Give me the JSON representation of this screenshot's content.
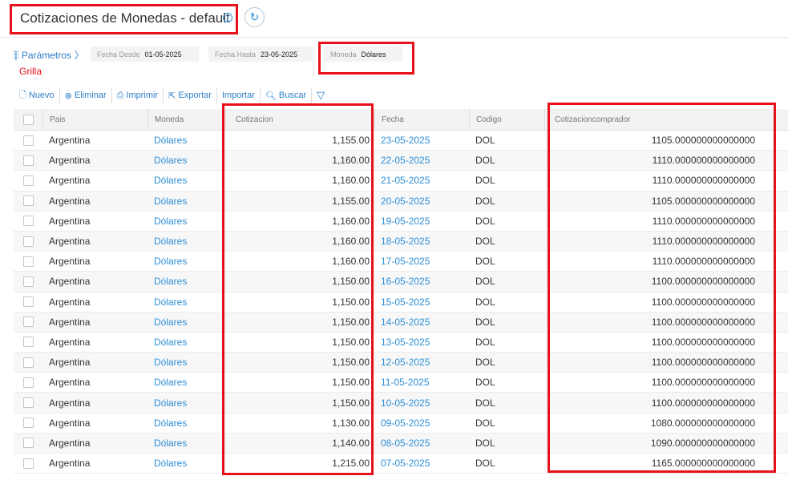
{
  "header": {
    "title": "Cotizaciones de Monedas - default",
    "info_icon": "info-icon",
    "refresh_icon": "refresh-icon"
  },
  "params": {
    "label": "Parámetros",
    "filters": {
      "fecha_desde": {
        "label": "Fecha Desde",
        "value": "01-05-2025"
      },
      "fecha_hasta": {
        "label": "Fecha Hasta",
        "value": "23-05-2025"
      },
      "moneda": {
        "label": "Moneda",
        "value": "Dólares"
      }
    }
  },
  "grilla_label": "Grilla",
  "toolbar": {
    "nuevo": "Nuevo",
    "eliminar": "Eliminar",
    "imprimir": "Imprimir",
    "exportar": "Exportar",
    "importar": "Importar",
    "buscar": "Buscar"
  },
  "table": {
    "columns": [
      "Pais",
      "Moneda",
      "Cotizacion",
      "Fecha",
      "Codigo",
      "Cotizacioncomprador"
    ],
    "rows": [
      {
        "pais": "Argentina",
        "moneda": "Dólares",
        "cotizacion": "1,155.00",
        "fecha": "23-05-2025",
        "codigo": "DOL",
        "comprador": "1105.000000000000000"
      },
      {
        "pais": "Argentina",
        "moneda": "Dólares",
        "cotizacion": "1,160.00",
        "fecha": "22-05-2025",
        "codigo": "DOL",
        "comprador": "1110.000000000000000"
      },
      {
        "pais": "Argentina",
        "moneda": "Dólares",
        "cotizacion": "1,160.00",
        "fecha": "21-05-2025",
        "codigo": "DOL",
        "comprador": "1110.000000000000000"
      },
      {
        "pais": "Argentina",
        "moneda": "Dólares",
        "cotizacion": "1,155.00",
        "fecha": "20-05-2025",
        "codigo": "DOL",
        "comprador": "1105.000000000000000"
      },
      {
        "pais": "Argentina",
        "moneda": "Dólares",
        "cotizacion": "1,160.00",
        "fecha": "19-05-2025",
        "codigo": "DOL",
        "comprador": "1110.000000000000000"
      },
      {
        "pais": "Argentina",
        "moneda": "Dólares",
        "cotizacion": "1,160.00",
        "fecha": "18-05-2025",
        "codigo": "DOL",
        "comprador": "1110.000000000000000"
      },
      {
        "pais": "Argentina",
        "moneda": "Dólares",
        "cotizacion": "1,160.00",
        "fecha": "17-05-2025",
        "codigo": "DOL",
        "comprador": "1110.000000000000000"
      },
      {
        "pais": "Argentina",
        "moneda": "Dólares",
        "cotizacion": "1,150.00",
        "fecha": "16-05-2025",
        "codigo": "DOL",
        "comprador": "1100.000000000000000"
      },
      {
        "pais": "Argentina",
        "moneda": "Dólares",
        "cotizacion": "1,150.00",
        "fecha": "15-05-2025",
        "codigo": "DOL",
        "comprador": "1100.000000000000000"
      },
      {
        "pais": "Argentina",
        "moneda": "Dólares",
        "cotizacion": "1,150.00",
        "fecha": "14-05-2025",
        "codigo": "DOL",
        "comprador": "1100.000000000000000"
      },
      {
        "pais": "Argentina",
        "moneda": "Dólares",
        "cotizacion": "1,150.00",
        "fecha": "13-05-2025",
        "codigo": "DOL",
        "comprador": "1100.000000000000000"
      },
      {
        "pais": "Argentina",
        "moneda": "Dólares",
        "cotizacion": "1,150.00",
        "fecha": "12-05-2025",
        "codigo": "DOL",
        "comprador": "1100.000000000000000"
      },
      {
        "pais": "Argentina",
        "moneda": "Dólares",
        "cotizacion": "1,150.00",
        "fecha": "11-05-2025",
        "codigo": "DOL",
        "comprador": "1100.000000000000000"
      },
      {
        "pais": "Argentina",
        "moneda": "Dólares",
        "cotizacion": "1,150.00",
        "fecha": "10-05-2025",
        "codigo": "DOL",
        "comprador": "1100.000000000000000"
      },
      {
        "pais": "Argentina",
        "moneda": "Dólares",
        "cotizacion": "1,130.00",
        "fecha": "09-05-2025",
        "codigo": "DOL",
        "comprador": "1080.000000000000000"
      },
      {
        "pais": "Argentina",
        "moneda": "Dólares",
        "cotizacion": "1,140.00",
        "fecha": "08-05-2025",
        "codigo": "DOL",
        "comprador": "1090.000000000000000"
      },
      {
        "pais": "Argentina",
        "moneda": "Dólares",
        "cotizacion": "1,215.00",
        "fecha": "07-05-2025",
        "codigo": "DOL",
        "comprador": "1165.000000000000000"
      }
    ]
  },
  "colors": {
    "accent": "#2e8fd6",
    "highlight": "#e8101a",
    "header_bg": "#f3f3f3"
  }
}
